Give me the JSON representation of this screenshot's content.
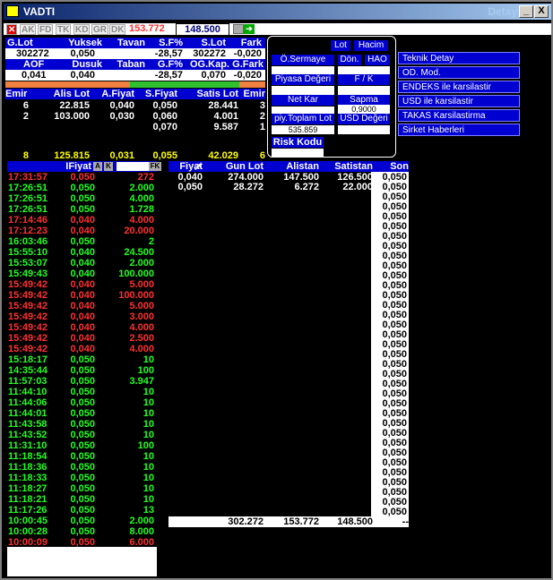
{
  "window": {
    "title": "VADTI",
    "detay": "Detay",
    "min": "_",
    "max": "□",
    "close": "X"
  },
  "toolbar": {
    "items": [
      "AK",
      "FD",
      "TK",
      "KD",
      "GR",
      "DK"
    ],
    "price_red": "153.772",
    "price_blue": "148.500"
  },
  "info": {
    "h1": [
      "G.Lot",
      "Yuksek",
      "Tavan",
      "S.F%",
      "S.Lot",
      "Fark"
    ],
    "r1": [
      "302272",
      "0,050",
      "",
      "-28,57",
      "302272",
      "-0,020"
    ],
    "h2": [
      "AOF",
      "Dusuk",
      "Taban",
      "G.F%",
      "OG.Kap.",
      "G.Fark"
    ],
    "r2": [
      "0,041",
      "0,040",
      "",
      "-28,57",
      "0,070",
      "-0,020"
    ],
    "h3": [
      "Emir",
      "Alis Lot",
      "A.Fiyat",
      "S.Fiyat",
      "Satis Lot",
      "Emir"
    ],
    "book": [
      [
        "6",
        "22.815",
        "0,040",
        "0,050",
        "28.441",
        "3"
      ],
      [
        "2",
        "103.000",
        "0,030",
        "0,060",
        "4.001",
        "2"
      ],
      [
        "",
        "",
        "",
        "0,070",
        "9.587",
        "1"
      ]
    ],
    "sum": [
      "8",
      "125.815",
      "0,031",
      "0,055",
      "42.029",
      "6"
    ]
  },
  "panel": {
    "lot": "Lot",
    "hacim": "Hacim",
    "osermaye": "Ö.Sermaye",
    "don": "Dön.",
    "hao": "HAO",
    "piyasa": "Piyasa Değeri",
    "fk": "F / K",
    "netkar": "Net Kar",
    "sapma": "Sapma",
    "sapma_val": "0,9000",
    "piytoplam": "piy.Toplam Lot",
    "piytoplam_val": "535.859",
    "usd": "USD Değeri",
    "risk": "Risk Kodu"
  },
  "menu": [
    "Teknik Detay",
    "OD. Mod.",
    "ENDEKS ile karsilastir",
    "USD ile karsilastir",
    "TAKAS Karsilastirma",
    "Sirket Haberleri"
  ],
  "trades_header": {
    "fiyat": "IFiyat",
    "a": "A",
    "k": "K",
    "fk": "FK"
  },
  "trades": [
    [
      "17:31:57",
      "0,050",
      "272",
      "r"
    ],
    [
      "17:26:51",
      "0,050",
      "2.000",
      "g"
    ],
    [
      "17:26:51",
      "0,050",
      "4.000",
      "g"
    ],
    [
      "17:26:51",
      "0,050",
      "1.728",
      "g"
    ],
    [
      "17:14:46",
      "0,040",
      "4.000",
      "r"
    ],
    [
      "17:12:23",
      "0,040",
      "20.000",
      "r"
    ],
    [
      "16:03:46",
      "0,050",
      "2",
      "g"
    ],
    [
      "15:55:10",
      "0,040",
      "24.500",
      "g"
    ],
    [
      "15:53:07",
      "0,040",
      "2.000",
      "g"
    ],
    [
      "15:49:43",
      "0,040",
      "100.000",
      "g"
    ],
    [
      "15:49:42",
      "0,040",
      "5.000",
      "r"
    ],
    [
      "15:49:42",
      "0,040",
      "100.000",
      "r"
    ],
    [
      "15:49:42",
      "0,040",
      "5.000",
      "r"
    ],
    [
      "15:49:42",
      "0,040",
      "3.000",
      "r"
    ],
    [
      "15:49:42",
      "0,040",
      "4.000",
      "r"
    ],
    [
      "15:49:42",
      "0,040",
      "2.500",
      "r"
    ],
    [
      "15:49:42",
      "0,040",
      "4.000",
      "r"
    ],
    [
      "15:18:17",
      "0,050",
      "10",
      "g"
    ],
    [
      "14:35:44",
      "0,050",
      "100",
      "g"
    ],
    [
      "11:57:03",
      "0,050",
      "3.947",
      "g"
    ],
    [
      "11:44:10",
      "0,050",
      "10",
      "g"
    ],
    [
      "11:44:06",
      "0,050",
      "10",
      "g"
    ],
    [
      "11:44:01",
      "0,050",
      "10",
      "g"
    ],
    [
      "11:43:58",
      "0,050",
      "10",
      "g"
    ],
    [
      "11:43:52",
      "0,050",
      "10",
      "g"
    ],
    [
      "11:31:10",
      "0,050",
      "100",
      "g"
    ],
    [
      "11:18:54",
      "0,050",
      "10",
      "g"
    ],
    [
      "11:18:36",
      "0,050",
      "10",
      "g"
    ],
    [
      "11:18:33",
      "0,050",
      "10",
      "g"
    ],
    [
      "11:18:27",
      "0,050",
      "10",
      "g"
    ],
    [
      "11:18:21",
      "0,050",
      "10",
      "g"
    ],
    [
      "11:17:26",
      "0,050",
      "13",
      "g"
    ],
    [
      "10:00:45",
      "0,050",
      "2.000",
      "g"
    ],
    [
      "10:00:28",
      "0,050",
      "8.000",
      "g"
    ],
    [
      "10:00:09",
      "0,050",
      "6.000",
      "r"
    ]
  ],
  "depth_header": [
    "Fiyat",
    "Gun Lot",
    "Alistan",
    "Satistan",
    "Son"
  ],
  "depth": [
    [
      "0,040",
      "274.000",
      "147.500",
      "126.500"
    ],
    [
      "0,050",
      "28.272",
      "6.272",
      "22.000"
    ]
  ],
  "son_val": "0,050",
  "totals": [
    "302.272",
    "153.772",
    "148.500",
    "--"
  ]
}
